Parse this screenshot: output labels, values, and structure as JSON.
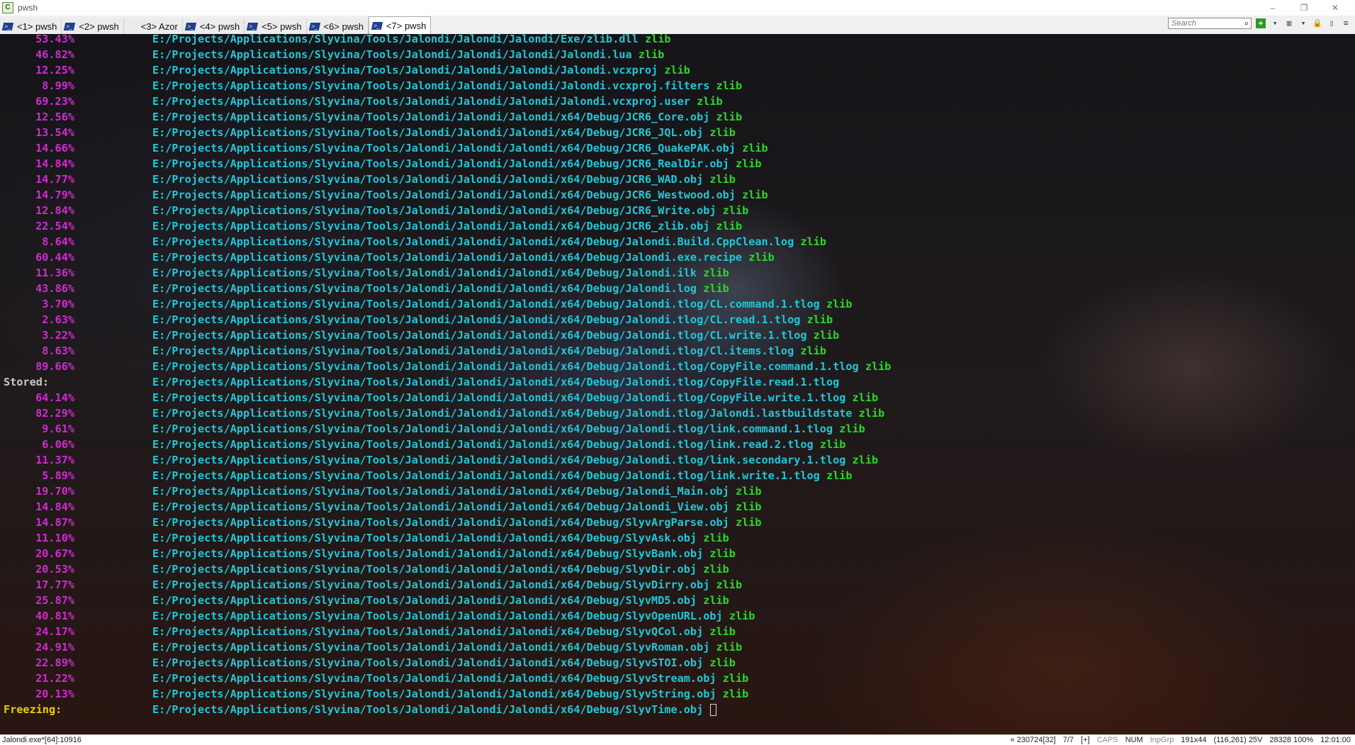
{
  "window": {
    "title": "pwsh",
    "app_icon_glyph": "C",
    "minimize_glyph": "–",
    "restore_glyph": "❐",
    "close_glyph": "✕"
  },
  "tabs": [
    {
      "label": "<1> pwsh",
      "icon": "powershell-icon",
      "active": false
    },
    {
      "label": "<2> pwsh",
      "icon": "powershell-icon",
      "active": false
    },
    {
      "label": "<3> Azor",
      "icon": "none",
      "active": false
    },
    {
      "label": "<4> pwsh",
      "icon": "powershell-icon",
      "active": false
    },
    {
      "label": "<5> pwsh",
      "icon": "powershell-icon",
      "active": false
    },
    {
      "label": "<6> pwsh",
      "icon": "powershell-icon",
      "active": false
    },
    {
      "label": "<7> pwsh",
      "icon": "powershell-icon",
      "active": true
    }
  ],
  "search": {
    "placeholder": "Search"
  },
  "colors": {
    "percent": "#d22ad2",
    "path": "#20c8d8",
    "algorithm": "#2ad82a",
    "stored_label": "#c8c8c8",
    "freezing_label": "#e8d000"
  },
  "terminal": {
    "lines": [
      {
        "pct": "53.43%",
        "path": "E:/Projects/Applications/Slyvina/Tools/Jalondi/Jalondi/Jalondi/Exe/zlib.dll",
        "algo": "zlib"
      },
      {
        "pct": "46.82%",
        "path": "E:/Projects/Applications/Slyvina/Tools/Jalondi/Jalondi/Jalondi/Jalondi.lua",
        "algo": "zlib"
      },
      {
        "pct": "12.25%",
        "path": "E:/Projects/Applications/Slyvina/Tools/Jalondi/Jalondi/Jalondi/Jalondi.vcxproj",
        "algo": "zlib"
      },
      {
        "pct": "8.99%",
        "path": "E:/Projects/Applications/Slyvina/Tools/Jalondi/Jalondi/Jalondi/Jalondi.vcxproj.filters",
        "algo": "zlib"
      },
      {
        "pct": "69.23%",
        "path": "E:/Projects/Applications/Slyvina/Tools/Jalondi/Jalondi/Jalondi/Jalondi.vcxproj.user",
        "algo": "zlib"
      },
      {
        "pct": "12.56%",
        "path": "E:/Projects/Applications/Slyvina/Tools/Jalondi/Jalondi/Jalondi/x64/Debug/JCR6_Core.obj",
        "algo": "zlib"
      },
      {
        "pct": "13.54%",
        "path": "E:/Projects/Applications/Slyvina/Tools/Jalondi/Jalondi/Jalondi/x64/Debug/JCR6_JQL.obj",
        "algo": "zlib"
      },
      {
        "pct": "14.66%",
        "path": "E:/Projects/Applications/Slyvina/Tools/Jalondi/Jalondi/Jalondi/x64/Debug/JCR6_QuakePAK.obj",
        "algo": "zlib"
      },
      {
        "pct": "14.84%",
        "path": "E:/Projects/Applications/Slyvina/Tools/Jalondi/Jalondi/Jalondi/x64/Debug/JCR6_RealDir.obj",
        "algo": "zlib"
      },
      {
        "pct": "14.77%",
        "path": "E:/Projects/Applications/Slyvina/Tools/Jalondi/Jalondi/Jalondi/x64/Debug/JCR6_WAD.obj",
        "algo": "zlib"
      },
      {
        "pct": "14.79%",
        "path": "E:/Projects/Applications/Slyvina/Tools/Jalondi/Jalondi/Jalondi/x64/Debug/JCR6_Westwood.obj",
        "algo": "zlib"
      },
      {
        "pct": "12.84%",
        "path": "E:/Projects/Applications/Slyvina/Tools/Jalondi/Jalondi/Jalondi/x64/Debug/JCR6_Write.obj",
        "algo": "zlib"
      },
      {
        "pct": "22.54%",
        "path": "E:/Projects/Applications/Slyvina/Tools/Jalondi/Jalondi/Jalondi/x64/Debug/JCR6_zlib.obj",
        "algo": "zlib"
      },
      {
        "pct": "8.64%",
        "path": "E:/Projects/Applications/Slyvina/Tools/Jalondi/Jalondi/Jalondi/x64/Debug/Jalondi.Build.CppClean.log",
        "algo": "zlib"
      },
      {
        "pct": "60.44%",
        "path": "E:/Projects/Applications/Slyvina/Tools/Jalondi/Jalondi/Jalondi/x64/Debug/Jalondi.exe.recipe",
        "algo": "zlib"
      },
      {
        "pct": "11.36%",
        "path": "E:/Projects/Applications/Slyvina/Tools/Jalondi/Jalondi/Jalondi/x64/Debug/Jalondi.ilk",
        "algo": "zlib"
      },
      {
        "pct": "43.86%",
        "path": "E:/Projects/Applications/Slyvina/Tools/Jalondi/Jalondi/Jalondi/x64/Debug/Jalondi.log",
        "algo": "zlib"
      },
      {
        "pct": "3.70%",
        "path": "E:/Projects/Applications/Slyvina/Tools/Jalondi/Jalondi/Jalondi/x64/Debug/Jalondi.tlog/CL.command.1.tlog",
        "algo": "zlib"
      },
      {
        "pct": "2.63%",
        "path": "E:/Projects/Applications/Slyvina/Tools/Jalondi/Jalondi/Jalondi/x64/Debug/Jalondi.tlog/CL.read.1.tlog",
        "algo": "zlib"
      },
      {
        "pct": "3.22%",
        "path": "E:/Projects/Applications/Slyvina/Tools/Jalondi/Jalondi/Jalondi/x64/Debug/Jalondi.tlog/CL.write.1.tlog",
        "algo": "zlib"
      },
      {
        "pct": "8.63%",
        "path": "E:/Projects/Applications/Slyvina/Tools/Jalondi/Jalondi/Jalondi/x64/Debug/Jalondi.tlog/Cl.items.tlog",
        "algo": "zlib"
      },
      {
        "pct": "89.66%",
        "path": "E:/Projects/Applications/Slyvina/Tools/Jalondi/Jalondi/Jalondi/x64/Debug/Jalondi.tlog/CopyFile.command.1.tlog",
        "algo": "zlib"
      },
      {
        "label": "Stored:",
        "label_type": "stored",
        "path": "E:/Projects/Applications/Slyvina/Tools/Jalondi/Jalondi/Jalondi/x64/Debug/Jalondi.tlog/CopyFile.read.1.tlog",
        "algo": ""
      },
      {
        "pct": "64.14%",
        "path": "E:/Projects/Applications/Slyvina/Tools/Jalondi/Jalondi/Jalondi/x64/Debug/Jalondi.tlog/CopyFile.write.1.tlog",
        "algo": "zlib"
      },
      {
        "pct": "82.29%",
        "path": "E:/Projects/Applications/Slyvina/Tools/Jalondi/Jalondi/Jalondi/x64/Debug/Jalondi.tlog/Jalondi.lastbuildstate",
        "algo": "zlib"
      },
      {
        "pct": "9.61%",
        "path": "E:/Projects/Applications/Slyvina/Tools/Jalondi/Jalondi/Jalondi/x64/Debug/Jalondi.tlog/link.command.1.tlog",
        "algo": "zlib"
      },
      {
        "pct": "6.06%",
        "path": "E:/Projects/Applications/Slyvina/Tools/Jalondi/Jalondi/Jalondi/x64/Debug/Jalondi.tlog/link.read.2.tlog",
        "algo": "zlib"
      },
      {
        "pct": "11.37%",
        "path": "E:/Projects/Applications/Slyvina/Tools/Jalondi/Jalondi/Jalondi/x64/Debug/Jalondi.tlog/link.secondary.1.tlog",
        "algo": "zlib"
      },
      {
        "pct": "5.89%",
        "path": "E:/Projects/Applications/Slyvina/Tools/Jalondi/Jalondi/Jalondi/x64/Debug/Jalondi.tlog/link.write.1.tlog",
        "algo": "zlib"
      },
      {
        "pct": "19.70%",
        "path": "E:/Projects/Applications/Slyvina/Tools/Jalondi/Jalondi/Jalondi/x64/Debug/Jalondi_Main.obj",
        "algo": "zlib"
      },
      {
        "pct": "14.84%",
        "path": "E:/Projects/Applications/Slyvina/Tools/Jalondi/Jalondi/Jalondi/x64/Debug/Jalondi_View.obj",
        "algo": "zlib"
      },
      {
        "pct": "14.87%",
        "path": "E:/Projects/Applications/Slyvina/Tools/Jalondi/Jalondi/Jalondi/x64/Debug/SlyvArgParse.obj",
        "algo": "zlib"
      },
      {
        "pct": "11.10%",
        "path": "E:/Projects/Applications/Slyvina/Tools/Jalondi/Jalondi/Jalondi/x64/Debug/SlyvAsk.obj",
        "algo": "zlib"
      },
      {
        "pct": "20.67%",
        "path": "E:/Projects/Applications/Slyvina/Tools/Jalondi/Jalondi/Jalondi/x64/Debug/SlyvBank.obj",
        "algo": "zlib"
      },
      {
        "pct": "20.53%",
        "path": "E:/Projects/Applications/Slyvina/Tools/Jalondi/Jalondi/Jalondi/x64/Debug/SlyvDir.obj",
        "algo": "zlib"
      },
      {
        "pct": "17.77%",
        "path": "E:/Projects/Applications/Slyvina/Tools/Jalondi/Jalondi/Jalondi/x64/Debug/SlyvDirry.obj",
        "algo": "zlib"
      },
      {
        "pct": "25.87%",
        "path": "E:/Projects/Applications/Slyvina/Tools/Jalondi/Jalondi/Jalondi/x64/Debug/SlyvMD5.obj",
        "algo": "zlib"
      },
      {
        "pct": "40.81%",
        "path": "E:/Projects/Applications/Slyvina/Tools/Jalondi/Jalondi/Jalondi/x64/Debug/SlyvOpenURL.obj",
        "algo": "zlib"
      },
      {
        "pct": "24.17%",
        "path": "E:/Projects/Applications/Slyvina/Tools/Jalondi/Jalondi/Jalondi/x64/Debug/SlyvQCol.obj",
        "algo": "zlib"
      },
      {
        "pct": "24.91%",
        "path": "E:/Projects/Applications/Slyvina/Tools/Jalondi/Jalondi/Jalondi/x64/Debug/SlyvRoman.obj",
        "algo": "zlib"
      },
      {
        "pct": "22.89%",
        "path": "E:/Projects/Applications/Slyvina/Tools/Jalondi/Jalondi/Jalondi/x64/Debug/SlyvSTOI.obj",
        "algo": "zlib"
      },
      {
        "pct": "21.22%",
        "path": "E:/Projects/Applications/Slyvina/Tools/Jalondi/Jalondi/Jalondi/x64/Debug/SlyvStream.obj",
        "algo": "zlib"
      },
      {
        "pct": "20.13%",
        "path": "E:/Projects/Applications/Slyvina/Tools/Jalondi/Jalondi/Jalondi/x64/Debug/SlyvString.obj",
        "algo": "zlib"
      },
      {
        "label": "Freezing:",
        "label_type": "freezing",
        "path": "E:/Projects/Applications/Slyvina/Tools/Jalondi/Jalondi/Jalondi/x64/Debug/SlyvTime.obj",
        "algo": "",
        "cursor": true
      }
    ]
  },
  "statusbar": {
    "process": "Jalondi.exe*[64]:10916",
    "buffer": "« 230724[32]",
    "console_index": "7/7",
    "plus": "[+]",
    "caps": "CAPS",
    "num": "NUM",
    "inpgrp": "InpGrp",
    "size": "191x44",
    "cursor_pos": "(116,261) 25V",
    "pid_zoom": "28328 100%",
    "time": "12:01:00"
  }
}
